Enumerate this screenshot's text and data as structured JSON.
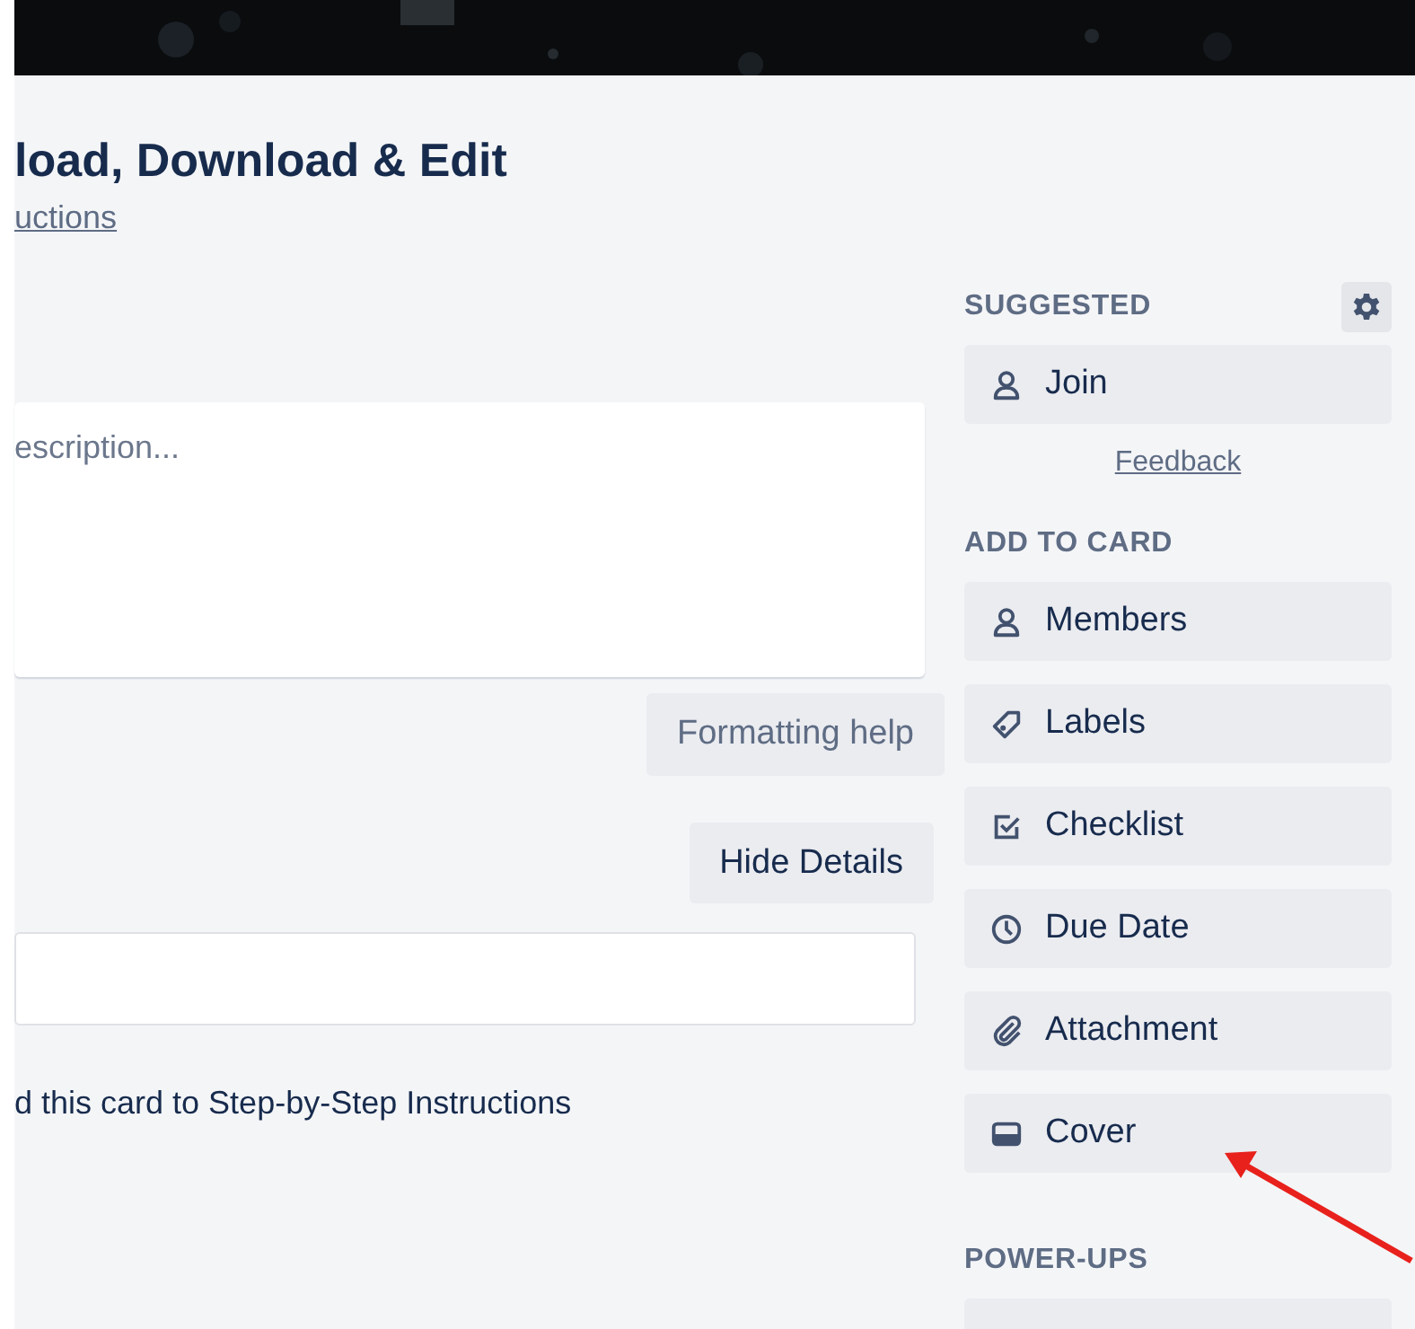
{
  "card": {
    "title": "load, Download & Edit",
    "list_link": "uctions",
    "description": {
      "placeholder": "escription..."
    },
    "formatting_help": "Formatting help",
    "hide_details": "Hide Details",
    "activity": "d this card to Step-by-Step Instructions"
  },
  "sidebar": {
    "sections": [
      {
        "heading": "SUGGESTED",
        "settings": true,
        "buttons": [
          {
            "label": "Join",
            "kind": "person"
          }
        ],
        "feedback": "Feedback"
      },
      {
        "heading": "ADD TO CARD",
        "settings": false,
        "buttons": [
          {
            "label": "Members",
            "kind": "person"
          },
          {
            "label": "Labels",
            "kind": "tag"
          },
          {
            "label": "Checklist",
            "kind": "checklist"
          },
          {
            "label": "Due Date",
            "kind": "clock"
          },
          {
            "label": "Attachment",
            "kind": "clip"
          },
          {
            "label": "Cover",
            "kind": "cover"
          }
        ]
      },
      {
        "heading": "POWER-UPS",
        "settings": false,
        "buttons": [
          {
            "kind": "blank"
          }
        ]
      }
    ]
  }
}
